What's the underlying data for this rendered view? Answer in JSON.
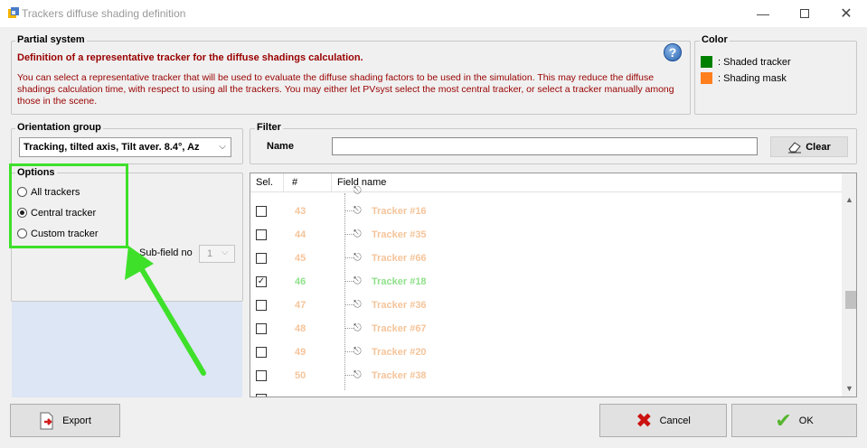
{
  "window": {
    "title": "Trackers diffuse shading definition",
    "minimize_icon": "minimize-icon",
    "maximize_icon": "maximize-icon",
    "close_icon": "close-icon"
  },
  "partial_system": {
    "legend": "Partial system",
    "heading": "Definition of a representative tracker for the diffuse shadings calculation.",
    "body": "You can select a representative tracker that will be used to evaluate the diffuse shading factors to be used in the simulation. This may reduce the diffuse shadings calculation time, with respect to using all the trackers. You may either let PVsyst select the most central tracker, or select a tracker manually among those in the scene.",
    "help_icon": "?"
  },
  "color_legend": {
    "legend": "Color",
    "items": [
      {
        "label": ": Shaded tracker",
        "color": "#008000"
      },
      {
        "label": ": Shading mask",
        "color": "#ff7f1e"
      }
    ]
  },
  "orientation_group": {
    "legend": "Orientation group",
    "selected": "Tracking, tilted axis, Tilt aver. 8.4°, Az"
  },
  "options": {
    "legend": "Options",
    "radios": [
      {
        "label": "All trackers",
        "checked": false
      },
      {
        "label": "Central tracker",
        "checked": true
      },
      {
        "label": "Custom tracker",
        "checked": false
      }
    ],
    "subfield_label": "Sub-field no",
    "subfield_value": "1"
  },
  "filter": {
    "legend": "Filter",
    "name_label": "Name",
    "name_value": "",
    "clear_label": "Clear"
  },
  "table": {
    "columns": [
      "Sel.",
      "#",
      "Field name"
    ],
    "rows": [
      {
        "num": "43",
        "name": "Tracker #16",
        "checked": false,
        "status": "mask"
      },
      {
        "num": "44",
        "name": "Tracker #35",
        "checked": false,
        "status": "mask"
      },
      {
        "num": "45",
        "name": "Tracker #66",
        "checked": false,
        "status": "mask"
      },
      {
        "num": "46",
        "name": "Tracker #18",
        "checked": true,
        "status": "shaded"
      },
      {
        "num": "47",
        "name": "Tracker #36",
        "checked": false,
        "status": "mask"
      },
      {
        "num": "48",
        "name": "Tracker #67",
        "checked": false,
        "status": "mask"
      },
      {
        "num": "49",
        "name": "Tracker #20",
        "checked": false,
        "status": "mask"
      },
      {
        "num": "50",
        "name": "Tracker #38",
        "checked": false,
        "status": "mask"
      }
    ],
    "mask_text_color": "#f5c49a",
    "shaded_text_color": "#8fe08a"
  },
  "buttons": {
    "export": "Export",
    "cancel": "Cancel",
    "ok": "OK"
  },
  "annotation": {
    "highlight_color": "#3ee02a"
  }
}
